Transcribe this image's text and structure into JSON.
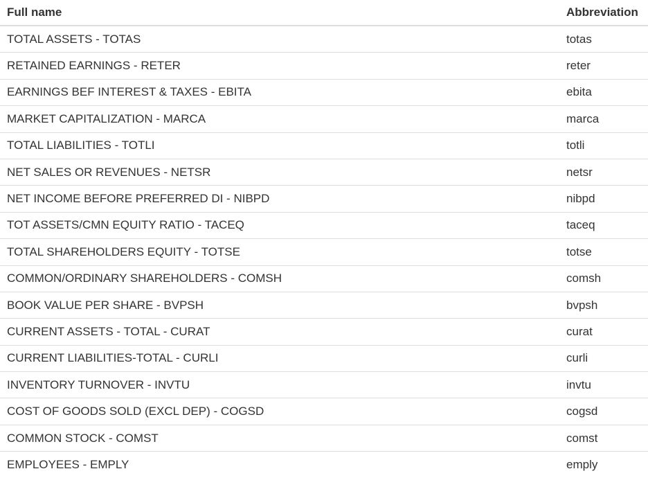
{
  "table": {
    "headers": {
      "full_name": "Full name",
      "abbreviation": "Abbreviation"
    },
    "rows": [
      {
        "full_name": "TOTAL ASSETS - TOTAS",
        "abbreviation": "totas"
      },
      {
        "full_name": "RETAINED EARNINGS - RETER",
        "abbreviation": "reter"
      },
      {
        "full_name": "EARNINGS BEF INTEREST & TAXES - EBITA",
        "abbreviation": "ebita"
      },
      {
        "full_name": "MARKET CAPITALIZATION - MARCA",
        "abbreviation": "marca"
      },
      {
        "full_name": "TOTAL LIABILITIES - TOTLI",
        "abbreviation": "totli"
      },
      {
        "full_name": "NET SALES OR REVENUES - NETSR",
        "abbreviation": "netsr"
      },
      {
        "full_name": "NET INCOME BEFORE PREFERRED DI - NIBPD",
        "abbreviation": "nibpd"
      },
      {
        "full_name": "TOT ASSETS/CMN EQUITY RATIO - TACEQ",
        "abbreviation": "taceq"
      },
      {
        "full_name": "TOTAL SHAREHOLDERS EQUITY - TOTSE",
        "abbreviation": "totse"
      },
      {
        "full_name": "COMMON/ORDINARY SHAREHOLDERS - COMSH",
        "abbreviation": "comsh"
      },
      {
        "full_name": "BOOK VALUE PER SHARE - BVPSH",
        "abbreviation": "bvpsh"
      },
      {
        "full_name": "CURRENT ASSETS - TOTAL - CURAT",
        "abbreviation": "curat"
      },
      {
        "full_name": "CURRENT LIABILITIES-TOTAL - CURLI",
        "abbreviation": "curli"
      },
      {
        "full_name": "INVENTORY TURNOVER - INVTU",
        "abbreviation": "invtu"
      },
      {
        "full_name": "COST OF GOODS SOLD (EXCL DEP) - COGSD",
        "abbreviation": "cogsd"
      },
      {
        "full_name": "COMMON STOCK - COMST",
        "abbreviation": "comst"
      },
      {
        "full_name": "EMPLOYEES - EMPLY",
        "abbreviation": "emply"
      }
    ]
  }
}
